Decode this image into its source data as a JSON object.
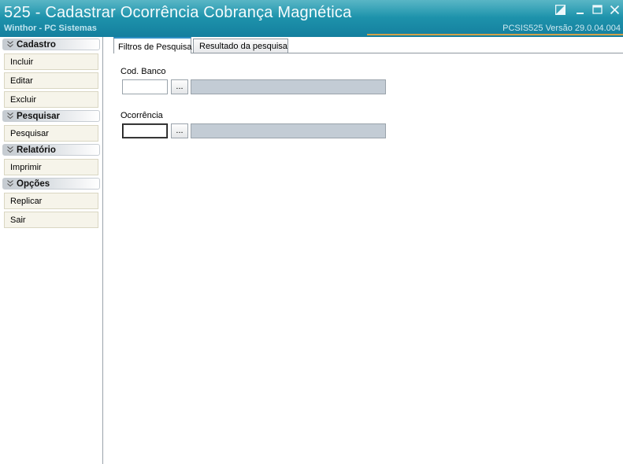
{
  "window": {
    "title": "525 - Cadastrar Ocorrência Cobrança Magnética",
    "subtitle": "Winthor - PC Sistemas",
    "version": "PCSIS525  Versão  29.0.04.004"
  },
  "sidebar": {
    "groups": [
      {
        "label": "Cadastro",
        "items": [
          {
            "label": "Incluir"
          },
          {
            "label": "Editar"
          },
          {
            "label": "Excluir"
          }
        ]
      },
      {
        "label": "Pesquisar",
        "items": [
          {
            "label": "Pesquisar"
          }
        ]
      },
      {
        "label": "Relatório",
        "items": [
          {
            "label": "Imprimir"
          }
        ]
      },
      {
        "label": "Opções",
        "items": [
          {
            "label": "Replicar"
          },
          {
            "label": "Sair"
          }
        ]
      }
    ]
  },
  "tabs": [
    {
      "label": "Filtros de Pesquisa",
      "active": true
    },
    {
      "label": "Resultado da pesquisa",
      "active": false
    }
  ],
  "filters": {
    "cod_banco": {
      "label": "Cod. Banco",
      "value": "",
      "button": "...",
      "description": ""
    },
    "ocorrencia": {
      "label": "Ocorrência",
      "value": "",
      "button": "...",
      "description": ""
    }
  },
  "colors": {
    "titlebar": "#1f95ad",
    "accent_line": "#d1a24a",
    "side_item_bg": "#f6f4ea",
    "readonly_field_bg": "#c3ccd5"
  },
  "icons": [
    "restore-icon",
    "minimize-icon",
    "maximize-icon",
    "close-icon",
    "chevron-down-icon"
  ]
}
